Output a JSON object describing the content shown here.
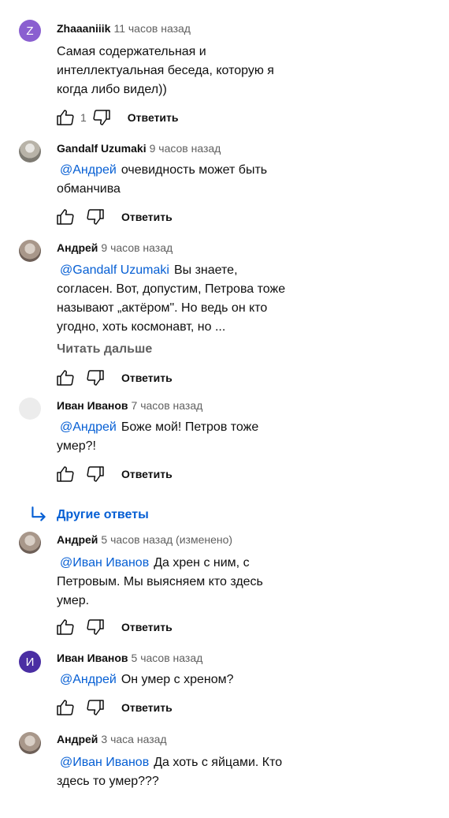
{
  "comments": [
    {
      "author": "Zhaaaniiik",
      "time": "11 часов назад",
      "avatar_letter": "Z",
      "avatar_color": "#8a5fd0",
      "mention": "",
      "text": "Самая содержательная и интеллектуальная беседа, которую я когда либо видел))",
      "likes": "1",
      "reply": "Ответить"
    },
    {
      "author": "Gandalf Uzumaki",
      "time": "9 часов назад",
      "mention": "@Андрей",
      "text": "очевидность может быть обманчива",
      "reply": "Ответить"
    },
    {
      "author": "Андрей",
      "time": "9 часов назад",
      "mention": "@Gandalf Uzumaki",
      "text": "Вы знаете, согласен. Вот, допустим, Петрова тоже называют „актёром\". Но ведь он кто угодно, хоть космонавт, но ...",
      "read_more": "Читать дальше",
      "reply": "Ответить"
    },
    {
      "author": "Иван Иванов",
      "time": "7 часов назад",
      "mention": "@Андрей",
      "text": "Боже мой! Петров тоже умер?!",
      "reply": "Ответить"
    },
    {
      "author": "Андрей",
      "time": "5 часов назад (изменено)",
      "mention": "@Иван Иванов",
      "text": "Да хрен с ним, с Петровым. Мы выясняем кто здесь умер.",
      "reply": "Ответить"
    },
    {
      "author": "Иван Иванов",
      "time": "5 часов назад",
      "avatar_letter": "И",
      "avatar_color": "#4a2ea3",
      "mention": "@Андрей",
      "text": "Он умер с хреном?",
      "reply": "Ответить"
    },
    {
      "author": "Андрей",
      "time": "3 часа назад",
      "mention": "@Иван Иванов",
      "text": "Да хоть с яйцами. Кто здесь то умер???"
    }
  ],
  "more_replies": "Другие ответы",
  "icons": {
    "like": "thumb-up-icon",
    "dislike": "thumb-down-icon",
    "more_replies": "reply-arrow-icon"
  }
}
